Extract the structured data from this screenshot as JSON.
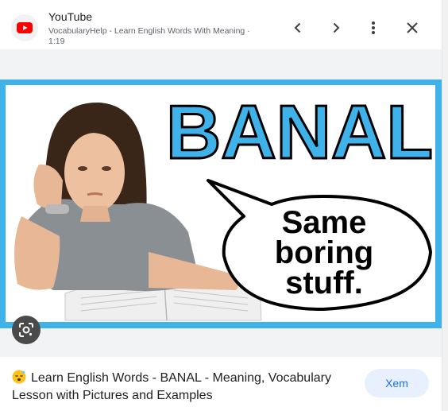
{
  "header": {
    "source_name": "YouTube",
    "subtitle": "VocabularyHelp - Learn English Words With Meaning · 1:19",
    "logo_icon": "youtube-logo-icon",
    "prev_icon": "chevron-left-icon",
    "next_icon": "chevron-right-icon",
    "more_icon": "more-vert-icon",
    "close_icon": "close-icon"
  },
  "thumbnail": {
    "headline": "BANAL",
    "bubble_lines": [
      "Same",
      "boring",
      "stuff."
    ],
    "frame_color": "#3fb2ea",
    "headline_color": "#3fb2ea"
  },
  "lens_icon": "google-lens-icon",
  "caption": {
    "emoji_icon": "sleeping-face-icon",
    "title": "Learn English Words - BANAL - Meaning, Vocabulary Lesson with Pictures and Examples"
  },
  "view_button": {
    "label": "Xem",
    "bg_color": "#e8f0fe",
    "text_color": "#1a73e8"
  }
}
